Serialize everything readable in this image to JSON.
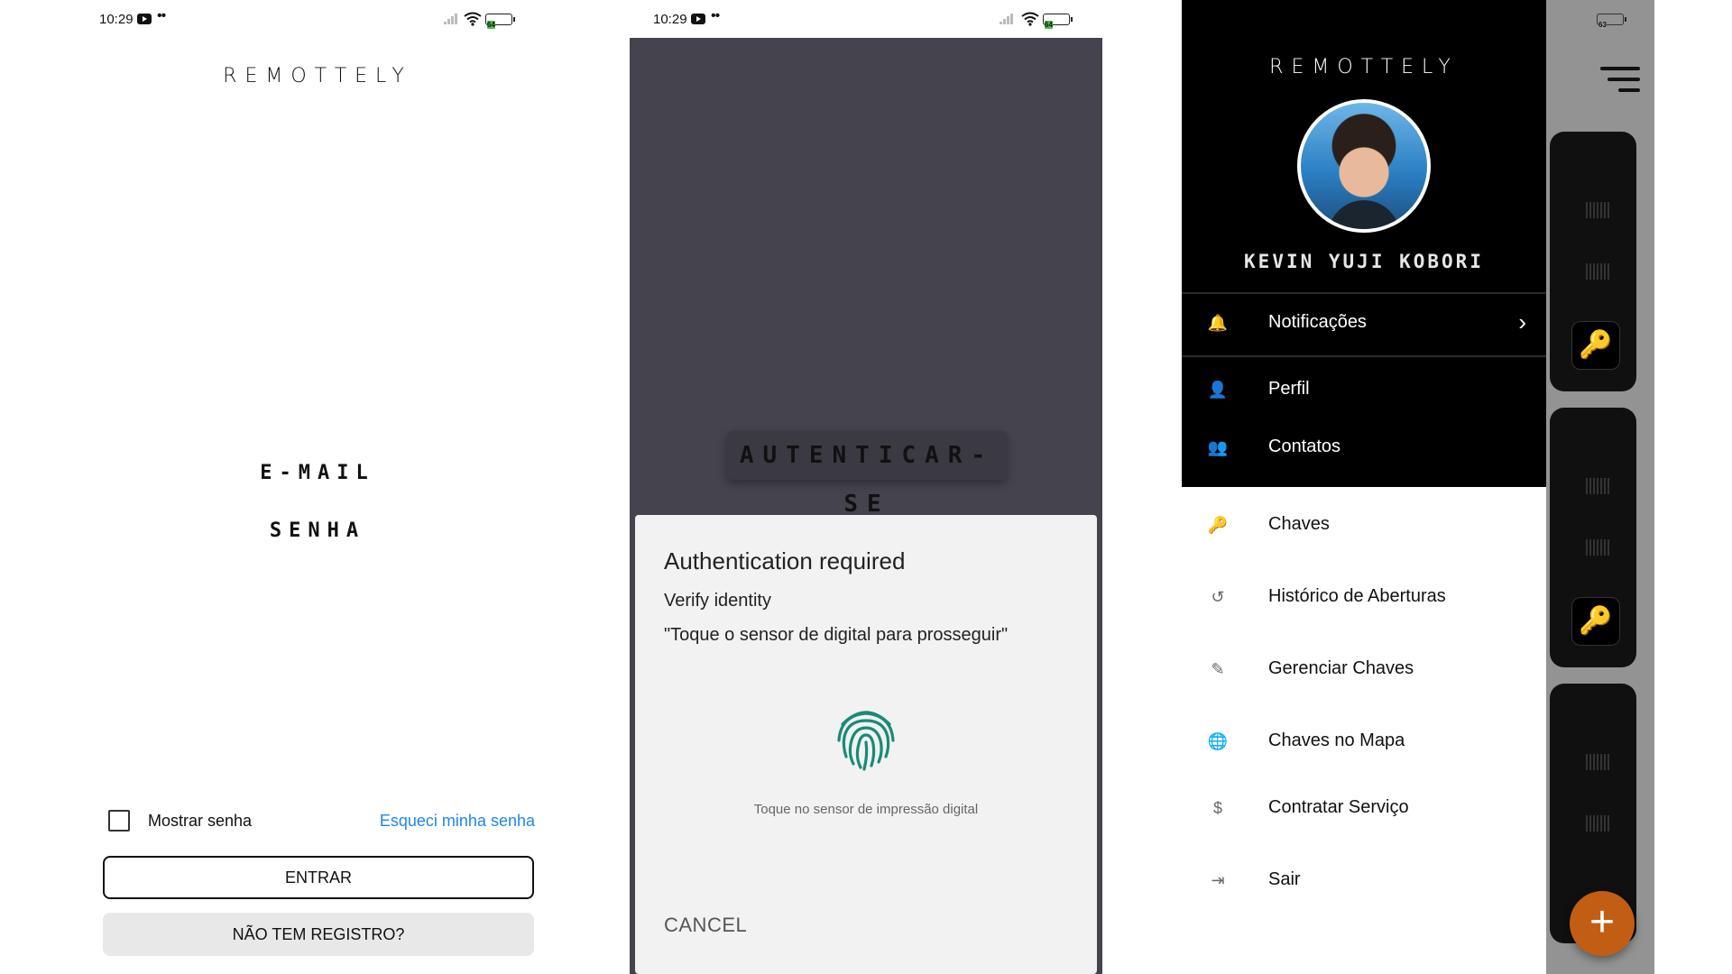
{
  "status_bar": {
    "time": "10:29",
    "dots": "••",
    "battery": "64",
    "battery_alt": "63",
    "battery_color": "#43c24a"
  },
  "brand": {
    "logo_text": "REMOTTELY"
  },
  "login": {
    "email_label": "E-MAIL",
    "password_label": "SENHA",
    "show_password_label": "Mostrar senha",
    "forgot_link": "Esqueci minha senha",
    "enter_button": "ENTRAR",
    "register_button": "NÃO TEM REGISTRO?",
    "link_color": "#1e88e5"
  },
  "auth": {
    "page_title": "AUTENTICAR-SE",
    "dialog": {
      "title": "Authentication required",
      "subtitle": "Verify identity",
      "description": "\"Toque o sensor de digital para prosseguir\"",
      "hint": "Toque no sensor de impressão digital",
      "cancel": "CANCEL",
      "fingerprint_color": "#1a8a78"
    }
  },
  "drawer": {
    "user_name": "KEVIN YUJI KOBORI",
    "items": [
      {
        "label": "Notificações",
        "icon": "bell-icon",
        "glyph": "🔔"
      },
      {
        "label": "Perfil",
        "icon": "person-icon",
        "glyph": "👤"
      },
      {
        "label": "Contatos",
        "icon": "group-icon",
        "glyph": "👥"
      },
      {
        "label": "Chaves",
        "icon": "key-icon",
        "glyph": "🔑"
      },
      {
        "label": "Histórico de Aberturas",
        "icon": "history-icon",
        "glyph": "↺"
      },
      {
        "label": "Gerenciar Chaves",
        "icon": "pencil-icon",
        "glyph": "✎"
      },
      {
        "label": "Chaves no Mapa",
        "icon": "globe-icon",
        "glyph": "🌐"
      },
      {
        "label": "Contratar Serviço",
        "icon": "dollar-icon",
        "glyph": "$"
      },
      {
        "label": "Sair",
        "icon": "logout-icon",
        "glyph": "⇥"
      }
    ],
    "chevron": "›",
    "fab_label": "+",
    "key_glyph": "🔑",
    "accent_color": "#c25e14"
  }
}
